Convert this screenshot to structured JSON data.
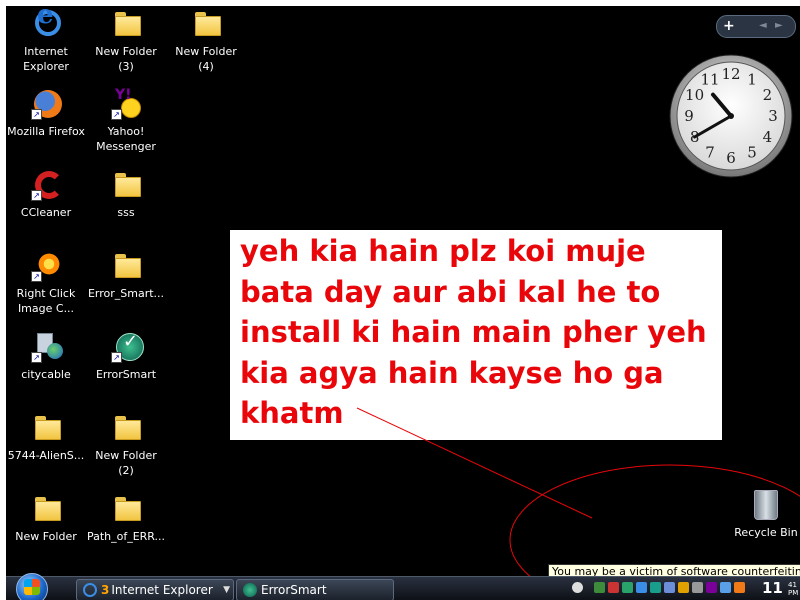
{
  "desktop_icons": [
    {
      "id": "internet-explorer",
      "label": "Internet\nExplorer"
    },
    {
      "id": "new-folder-3",
      "label": "New Folder\n(3)"
    },
    {
      "id": "new-folder-4",
      "label": "New Folder\n(4)"
    },
    {
      "id": "mozilla-firefox",
      "label": "Mozilla Firefox"
    },
    {
      "id": "yahoo-messenger",
      "label": "Yahoo!\nMessenger"
    },
    {
      "id": "ccleaner",
      "label": "CCleaner"
    },
    {
      "id": "sss",
      "label": "sss"
    },
    {
      "id": "right-click-image",
      "label": "Right Click\nImage C..."
    },
    {
      "id": "error-smart-folder",
      "label": "Error_Smart..."
    },
    {
      "id": "citycable",
      "label": "citycable"
    },
    {
      "id": "errorsmart",
      "label": "ErrorSmart"
    },
    {
      "id": "alien-folder",
      "label": "5744-AlienS..."
    },
    {
      "id": "new-folder-2",
      "label": "New Folder\n(2)"
    },
    {
      "id": "new-folder",
      "label": "New Folder"
    },
    {
      "id": "path-of-err",
      "label": "Path_of_ERR..."
    }
  ],
  "clock_gadget": {
    "hour": 10,
    "minute": 40,
    "numbers": [
      "12",
      "1",
      "2",
      "3",
      "4",
      "5",
      "6",
      "7",
      "8",
      "9",
      "10",
      "11"
    ]
  },
  "gadget_bar": {
    "add": "+",
    "prev": "◄",
    "next": "►"
  },
  "annotation": {
    "text": "yeh kia hain plz koi muje bata day aur abi kal he to install ki hain main pher yeh kia agya hain kayse ho ga khatm",
    "color": "#e8060a"
  },
  "recycle_bin": {
    "label": "Recycle Bin"
  },
  "tooltip": {
    "text": "You may be a victim of software counterfeiting"
  },
  "taskbar": {
    "ie_count": "3",
    "ie_label": "Internet Explorer",
    "errorsmart_label": "ErrorSmart",
    "dropdown": "▼",
    "clock": "11",
    "clock_suffix": "41\nPM"
  }
}
